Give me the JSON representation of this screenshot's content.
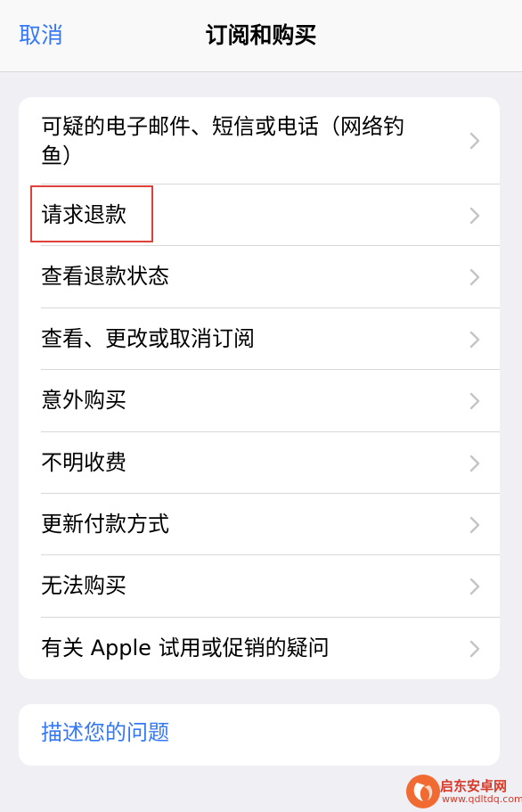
{
  "nav": {
    "cancel": "取消",
    "title": "订阅和购买"
  },
  "menu": {
    "items": [
      {
        "label": "可疑的电子邮件、短信或电话（网络钓鱼）"
      },
      {
        "label": "请求退款"
      },
      {
        "label": "查看退款状态"
      },
      {
        "label": "查看、更改或取消订阅"
      },
      {
        "label": "意外购买"
      },
      {
        "label": "不明收费"
      },
      {
        "label": "更新付款方式"
      },
      {
        "label": "无法购买"
      },
      {
        "label": "有关 Apple 试用或促销的疑问"
      }
    ]
  },
  "footer": {
    "describe_label": "描述您的问题"
  },
  "watermark": {
    "text": "启东安卓网",
    "url": "www.qdltdq.com"
  },
  "colors": {
    "accent": "#3478f6",
    "highlight": "#e0403a"
  },
  "icons": {
    "row_chevron": "chevron-right-icon"
  }
}
